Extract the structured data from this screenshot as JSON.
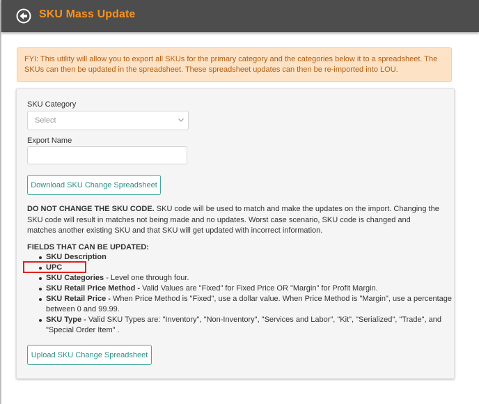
{
  "header": {
    "title": "SKU Mass Update",
    "back_icon": "circle-arrow-left-icon",
    "bg_color": "#4d4d4d",
    "title_color": "#f7921e"
  },
  "fyi": {
    "text": "FYI: This utility will allow you to export all SKUs for the primary category and the categories below it to a spreadsheet. The SKUs can then be updated in the spreadsheet. These spreadsheet updates can then be re-imported into LOU.",
    "bg_color": "#fde2c5",
    "text_color": "#b35c0e"
  },
  "form": {
    "category_label": "SKU Category",
    "category_value": "Select",
    "export_name_label": "Export Name",
    "export_name_value": "",
    "download_button": "Download SKU Change Spreadsheet",
    "upload_button": "Upload SKU Change Spreadsheet",
    "button_color": "#3fa89a"
  },
  "warning": {
    "bold": "DO NOT CHANGE THE SKU CODE.",
    "text": "  SKU code will be used to match and make the updates on the import. Changing the SKU code will result in matches not being made and no updates. Worst case scenario, SKU code is changed and matches another existing SKU and that SKU will get updated with incorrect information."
  },
  "fields": {
    "title": "FIELDS THAT CAN BE UPDATED:",
    "items": [
      {
        "name": "SKU Description",
        "desc": ""
      },
      {
        "name": "UPC",
        "desc": ""
      },
      {
        "name": "SKU Categories",
        "desc": " - Level one through four."
      },
      {
        "name": "SKU Retail Price Method -",
        "desc": " Valid Values are \"Fixed\" for Fixed Price OR \"Margin\" for Profit Margin."
      },
      {
        "name": "SKU Retail Price -",
        "desc": " When Price Method is \"Fixed\", use a dollar value. When Price Method is \"Margin\", use a percentage between 0 and 99.99."
      },
      {
        "name": "SKU Type -",
        "desc": " Valid SKU Types are: \"Inventory\", \"Non-Inventory\", \"Services and Labor\", \"Kit\", \"Serialized\", \"Trade\", and \"Special Order Item\" ."
      }
    ]
  },
  "annotation": {
    "highlight_color": "#e0201b"
  }
}
